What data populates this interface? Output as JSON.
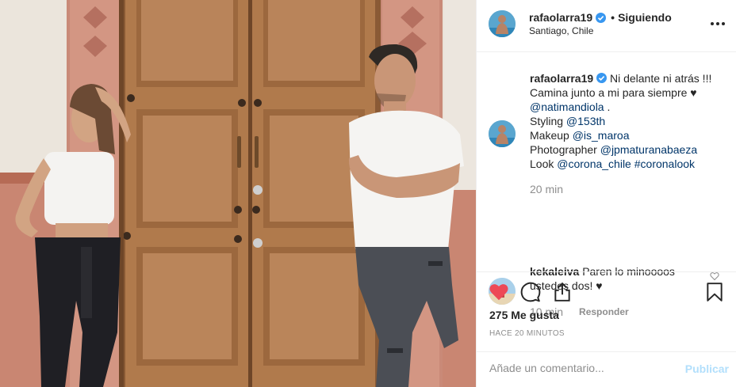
{
  "post": {
    "username": "rafaolarra19",
    "separator": "•",
    "follow_status": "Siguiendo",
    "location": "Santiago, Chile"
  },
  "caption": {
    "username": "rafaolarra19",
    "line1": "Ni delante ni atrás !!!",
    "line2": "Camina junto a mi para siempre ♥",
    "line3_mention": "@natimandiola",
    "line3_suffix": " .",
    "line4_label": "Styling ",
    "line4_mention": "@153th",
    "line5_label": "Makeup ",
    "line5_mention": "@is_maroa",
    "line6_label": "Photographer ",
    "line6_mention": "@jpmaturanabaeza",
    "line7_label": "Look ",
    "line7_mention": "@corona_chile",
    "line7_hashtag": "#coronalook",
    "time": "20 min"
  },
  "comment": {
    "username": "kekaleiva",
    "text": "Paren lo minoooos ustedes dos! ♥",
    "time": "10 min",
    "reply_label": "Responder"
  },
  "actions": {
    "likes": "275 Me gusta",
    "ago": "HACE 20 MINUTOS"
  },
  "add_comment": {
    "placeholder": "Añade un comentario...",
    "post_label": "Publicar"
  },
  "icons": {
    "verified": "verified-badge-icon",
    "more": "more-options-icon",
    "like": "heart-filled-icon",
    "comment": "comment-bubble-icon",
    "share": "share-icon",
    "save": "bookmark-icon",
    "comment_like": "heart-outline-icon"
  },
  "colors": {
    "like_red": "#ed4956",
    "link_blue": "#003569",
    "verified_blue": "#3897f0",
    "post_disabled": "#b2dffc",
    "muted": "#8e8e8e"
  }
}
